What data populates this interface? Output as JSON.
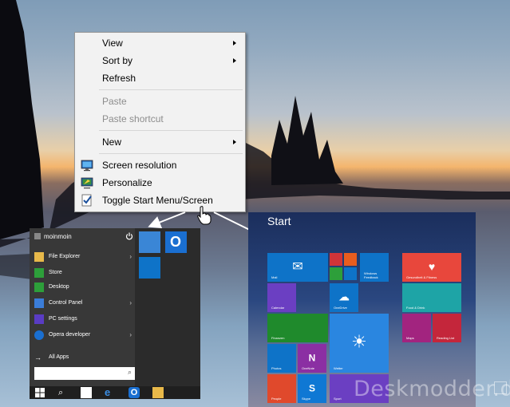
{
  "context_menu": {
    "items": [
      {
        "label": "View",
        "submenu": true,
        "enabled": true
      },
      {
        "label": "Sort by",
        "submenu": true,
        "enabled": true
      },
      {
        "label": "Refresh",
        "submenu": false,
        "enabled": true
      },
      {
        "label": "Paste",
        "submenu": false,
        "enabled": false
      },
      {
        "label": "Paste shortcut",
        "submenu": false,
        "enabled": false
      },
      {
        "label": "New",
        "submenu": true,
        "enabled": true
      },
      {
        "label": "Screen resolution",
        "icon": "monitor-icon",
        "enabled": true
      },
      {
        "label": "Personalize",
        "icon": "personalize-icon",
        "enabled": true
      },
      {
        "label": "Toggle Start Menu/Screen",
        "icon": "toggle-icon",
        "enabled": true
      }
    ]
  },
  "start_menu": {
    "username": "moinmoin",
    "items": [
      {
        "label": "File Explorer",
        "icon": "folder-icon",
        "submenu": true,
        "color": "#e8b94a"
      },
      {
        "label": "Store",
        "icon": "store-icon",
        "submenu": false,
        "color": "#2d9f3a"
      },
      {
        "label": "Desktop",
        "icon": "desktop-icon",
        "submenu": false,
        "color": "#2d9f3a"
      },
      {
        "label": "Control Panel",
        "icon": "control-panel-icon",
        "submenu": true,
        "color": "#3b7dd8"
      },
      {
        "label": "PC settings",
        "icon": "gear-icon",
        "submenu": false,
        "color": "#5a3cc4"
      },
      {
        "label": "Opera developer",
        "icon": "opera-icon",
        "submenu": true,
        "color": "#1a6fd1"
      }
    ],
    "all_apps": "All Apps",
    "search_placeholder": ""
  },
  "start_screen": {
    "title": "Start",
    "tiles": [
      "Mail",
      "Calendar",
      "OneDrive",
      "Windows Feedback",
      "Finanzen",
      "Wetter",
      "Photos",
      "OneNote",
      "People",
      "Skype",
      "Sport",
      "Gesundheit & Fitness",
      "Food & Drink",
      "Maps",
      "Reading List"
    ]
  },
  "watermark": "Deskmodder.de",
  "colors": {
    "menu_bg": "#f2f2f2",
    "start_bg": "#383838",
    "tile_blue": "#0e73c8",
    "tile_green": "#2d9f3a",
    "tile_red": "#d13438"
  }
}
